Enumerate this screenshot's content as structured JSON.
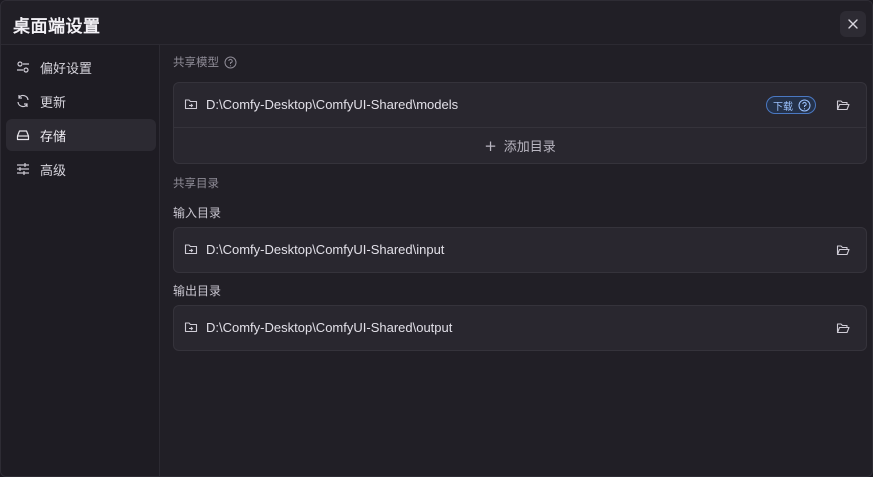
{
  "window": {
    "title": "桌面端设置"
  },
  "sidebar": {
    "items": [
      {
        "label": "偏好设置",
        "icon": "sliders-icon",
        "active": false
      },
      {
        "label": "更新",
        "icon": "refresh-icon",
        "active": false
      },
      {
        "label": "存储",
        "icon": "hard-drive-icon",
        "active": true
      },
      {
        "label": "高级",
        "icon": "settings-sliders-icon",
        "active": false
      }
    ]
  },
  "shared_models": {
    "label": "共享模型",
    "paths": [
      {
        "path": "D:\\Comfy-Desktop\\ComfyUI-Shared\\models",
        "badge": "下载"
      }
    ],
    "add_label": "添加目录"
  },
  "shared_dirs": {
    "label": "共享目录",
    "input": {
      "label": "输入目录",
      "path": "D:\\Comfy-Desktop\\ComfyUI-Shared\\input"
    },
    "output": {
      "label": "输出目录",
      "path": "D:\\Comfy-Desktop\\ComfyUI-Shared\\output"
    }
  },
  "colors": {
    "background": "#211f26",
    "sidebar": "#1e1c23",
    "card": "#29272f",
    "accent": "#4a78c2"
  }
}
